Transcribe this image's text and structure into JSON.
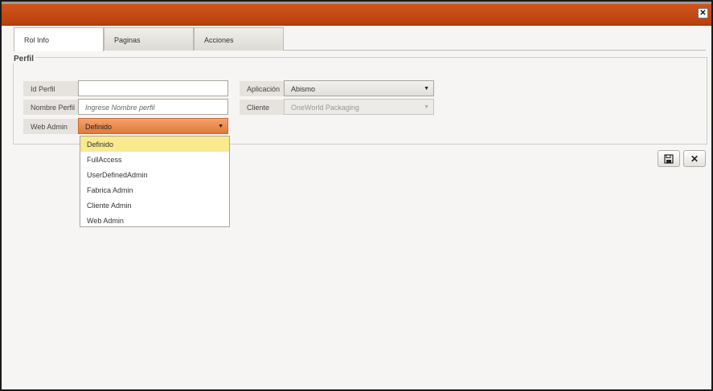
{
  "window": {
    "close_label": "✕"
  },
  "tabs": [
    {
      "label": "Rol Info"
    },
    {
      "label": "Paginas"
    },
    {
      "label": "Acciones"
    }
  ],
  "fieldset": {
    "legend": "Perfil"
  },
  "form": {
    "id_perfil": {
      "label": "Id Perfil",
      "value": ""
    },
    "nombre_perfil": {
      "label": "Nombre Perfil",
      "placeholder": "Ingrese Nombre perfil"
    },
    "web_admin": {
      "label": "Web Admin",
      "value": "Definido"
    },
    "aplicacion": {
      "label": "Aplicación",
      "value": "Abismo"
    },
    "cliente": {
      "label": "Cliente",
      "value": "OneWorld Packaging"
    }
  },
  "dropdown": {
    "options": [
      "Definido",
      "FullAccess",
      "UserDefinedAdmin",
      "Fabrica Admin",
      "Cliente Admin",
      "Web Admin"
    ],
    "selected": "Definido"
  },
  "actions": {
    "save_icon": "floppy-disk-icon",
    "close_glyph": "✕"
  },
  "colors": {
    "titlebar": "#c44b16",
    "highlight": "#f9ea8e",
    "orange_select": "#e07a3a"
  }
}
